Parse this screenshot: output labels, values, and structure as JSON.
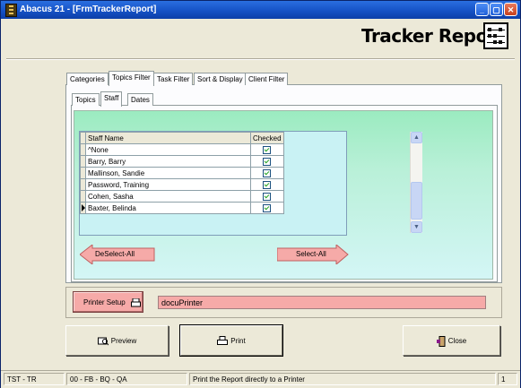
{
  "window": {
    "title": "Abacus 21 - [FrmTrackerReport]"
  },
  "header": {
    "title": "Tracker Report",
    "logo_icon": "abacus-icon"
  },
  "tabs": [
    {
      "label": "Categories"
    },
    {
      "label": "Topics Filter",
      "active": true
    },
    {
      "label": "Task Filter"
    },
    {
      "label": "Sort & Display"
    },
    {
      "label": "Client Filter"
    }
  ],
  "subtabs": [
    {
      "label": "Topics"
    },
    {
      "label": "Staff",
      "active": true
    },
    {
      "label": "Dates"
    }
  ],
  "grid": {
    "headers": {
      "name": "Staff Name",
      "checked": "Checked"
    },
    "rows": [
      {
        "name": "^None",
        "checked": true
      },
      {
        "name": "Barry, Barry",
        "checked": true
      },
      {
        "name": "Mallinson, Sandie",
        "checked": true
      },
      {
        "name": "Password, Training",
        "checked": true
      },
      {
        "name": "Cohen, Sasha",
        "checked": true
      },
      {
        "name": "Baxter, Belinda",
        "checked": true,
        "current": true
      }
    ]
  },
  "buttons": {
    "deselect_all": "DeSelect-All",
    "select_all": "Select-All",
    "printer_setup": "Printer Setup",
    "preview": "Preview",
    "print": "Print",
    "close": "Close"
  },
  "printer": {
    "value": "docuPrinter"
  },
  "status": {
    "pane1": "TST - TR",
    "pane2": "00 - FB - BQ - QA",
    "pane3": "Print the Report directly to a Printer",
    "pane4": "1"
  },
  "colors": {
    "accent_green": "#9bebc0",
    "accent_pink": "#f6aaa8",
    "titlebar": "#1652c6"
  }
}
